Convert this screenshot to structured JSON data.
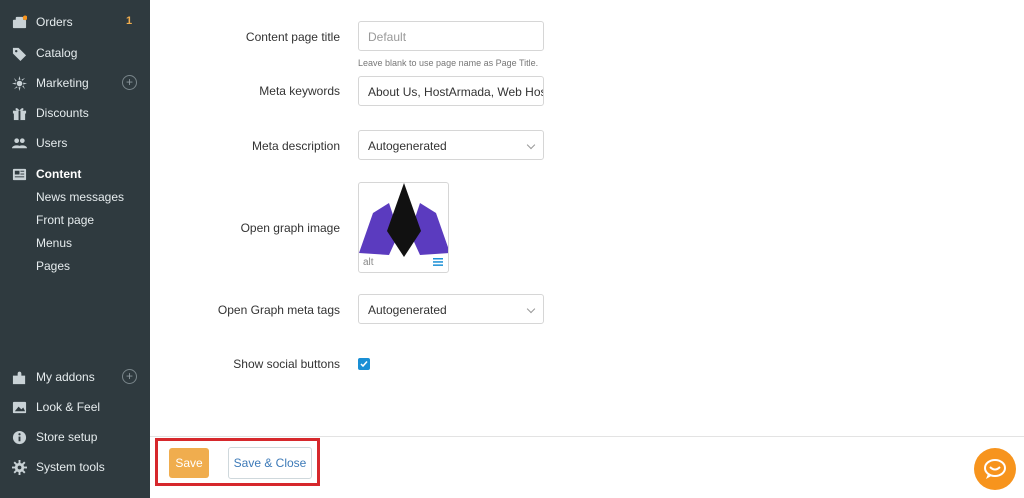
{
  "sidebar": {
    "items": [
      {
        "label": "Orders",
        "icon": "orders-icon",
        "badge": "1"
      },
      {
        "label": "Catalog",
        "icon": "tag-icon"
      },
      {
        "label": "Marketing",
        "icon": "marketing-icon",
        "has_add": true
      },
      {
        "label": "Discounts",
        "icon": "gift-icon"
      },
      {
        "label": "Users",
        "icon": "users-icon"
      },
      {
        "label": "Content",
        "icon": "content-icon",
        "active": true
      },
      {
        "label": "My addons",
        "icon": "puzzle-icon",
        "has_add": true
      },
      {
        "label": "Look & Feel",
        "icon": "image-icon"
      },
      {
        "label": "Store setup",
        "icon": "info-icon"
      },
      {
        "label": "System tools",
        "icon": "gear-icon"
      }
    ],
    "subitems": [
      "News messages",
      "Front page",
      "Menus",
      "Pages"
    ],
    "add_symbol": "+"
  },
  "form": {
    "content_page_title": {
      "label": "Content page title",
      "placeholder": "Default",
      "hint": "Leave blank to use page name as Page Title."
    },
    "meta_keywords": {
      "label": "Meta keywords",
      "value": "About Us, HostArmada, Web Host"
    },
    "meta_description": {
      "label": "Meta description",
      "value": "Autogenerated"
    },
    "og_image": {
      "label": "Open graph image",
      "alt_text": "alt"
    },
    "og_meta_tags": {
      "label": "Open Graph meta tags",
      "value": "Autogenerated"
    },
    "social_buttons": {
      "label": "Show social buttons",
      "checked": true
    }
  },
  "bottombar": {
    "save_label": "Save",
    "save_close_label": "Save & Close"
  },
  "colors": {
    "sidebar_bg": "#2f3a3f",
    "accent_orange": "#f0ad4e",
    "checkbox_blue": "#1a8fd5",
    "highlight_red": "#d6282c",
    "chat_orange": "#f7941d"
  }
}
